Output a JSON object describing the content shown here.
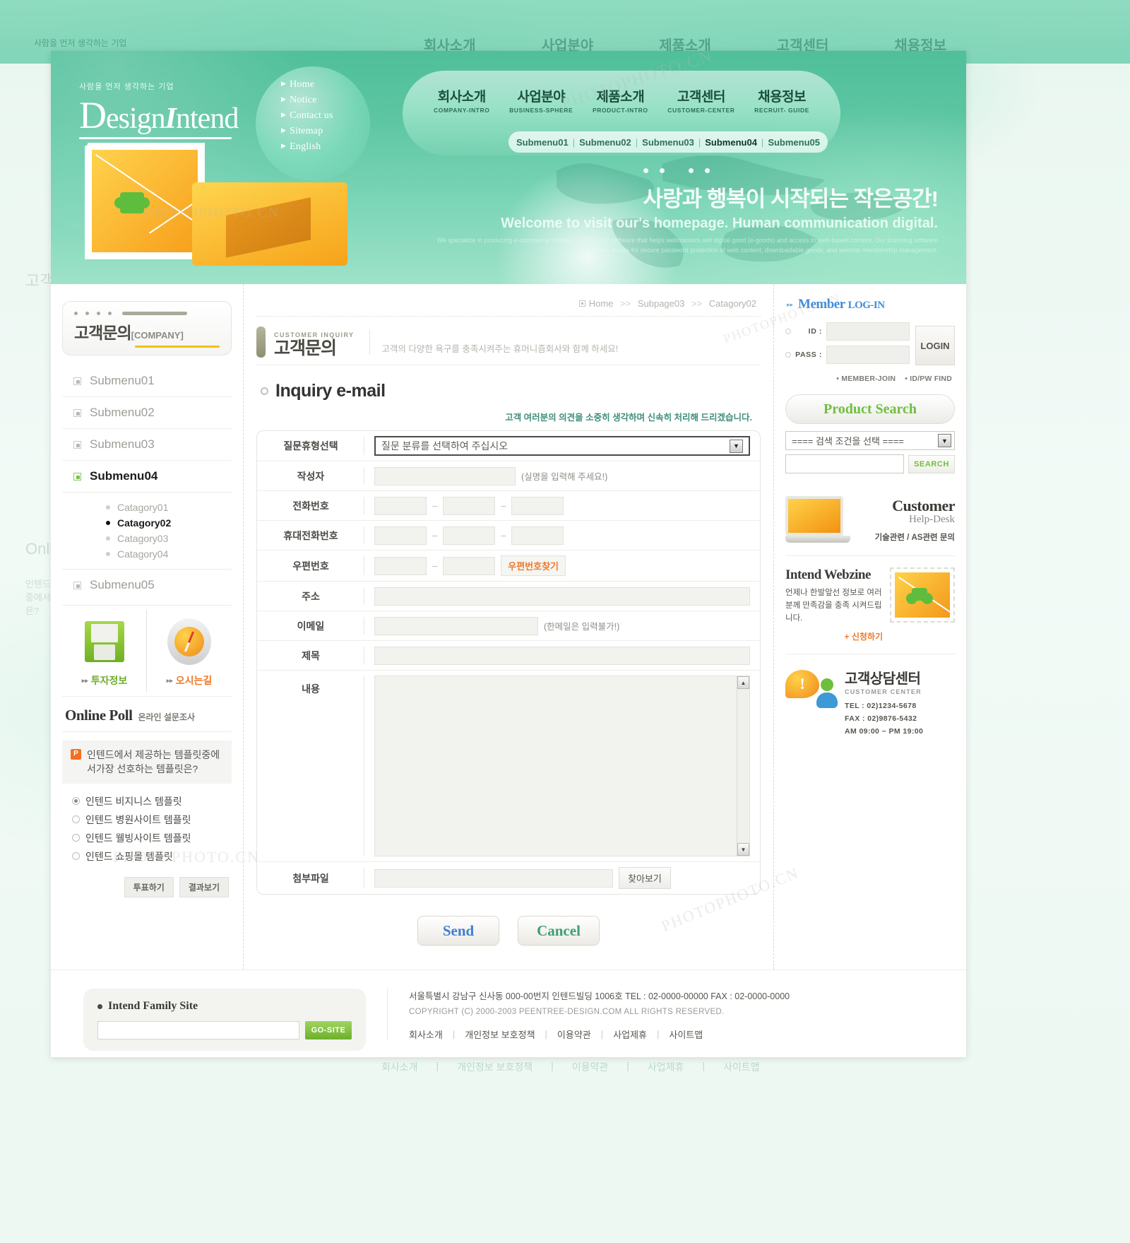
{
  "brand": {
    "tagline": "사람을 먼저 생각하는 기업",
    "name_d": "D",
    "name_rest": "esign",
    "name_i": "I",
    "name_end": "ntend"
  },
  "quicknav": [
    {
      "label": "Home"
    },
    {
      "label": "Notice"
    },
    {
      "label": "Contact us"
    },
    {
      "label": "Sitemap"
    },
    {
      "label": "English"
    }
  ],
  "gnb": [
    {
      "ko": "회사소개",
      "en": "COMPANY-INTRO"
    },
    {
      "ko": "사업분야",
      "en": "BUSINESS-SPHERE"
    },
    {
      "ko": "제품소개",
      "en": "PRODUCT-INTRO"
    },
    {
      "ko": "고객센터",
      "en": "CUSTOMER-CENTER"
    },
    {
      "ko": "채용정보",
      "en": "RECRUIT- GUIDE"
    }
  ],
  "submenus": [
    {
      "label": "Submenu01",
      "active": false
    },
    {
      "label": "Submenu02",
      "active": false
    },
    {
      "label": "Submenu03",
      "active": false
    },
    {
      "label": "Submenu04",
      "active": true
    },
    {
      "label": "Submenu05",
      "active": false
    }
  ],
  "hero": {
    "korean": "사랑과 행복이 시작되는 작은공간!",
    "english": "Welcome to visit our's homepage. Human communication digital.",
    "small": "We specialize in producing e-commerce software, particularly software that helps webmasters sell digital good (e-goods) and access to web-based content. Our licensing software includes scripts for secure password protection of web content, downloadable goods, and website membership management."
  },
  "sidebar": {
    "page_title": "고객문의",
    "page_title_suffix": "[COMPANY]",
    "menu": [
      {
        "label": "Submenu01",
        "active": false
      },
      {
        "label": "Submenu02",
        "active": false
      },
      {
        "label": "Submenu03",
        "active": false
      },
      {
        "label": "Submenu04",
        "active": true
      },
      {
        "label": "Submenu05",
        "active": false
      }
    ],
    "categories": [
      {
        "label": "Catagory01",
        "active": false
      },
      {
        "label": "Catagory02",
        "active": true
      },
      {
        "label": "Catagory03",
        "active": false
      },
      {
        "label": "Catagory04",
        "active": false
      }
    ],
    "banners": [
      {
        "label": "투자정보",
        "arrow": "▸▸",
        "icon": "floppy-disk-icon"
      },
      {
        "label": "오시는길",
        "arrow": "▸▸",
        "icon": "compass-icon"
      }
    ],
    "poll": {
      "title_en": "Online Poll",
      "title_ko": "온라인 설문조사",
      "badge": "P",
      "question": "인텐드에서 제공하는 템플릿중에서가장 선호하는 템플릿은?",
      "options": [
        {
          "label": "인텐드 비지니스 템플릿",
          "selected": true
        },
        {
          "label": "인텐드 병원사이트 템플릿",
          "selected": false
        },
        {
          "label": "인텐드 웰빙사이트 템플릿",
          "selected": false
        },
        {
          "label": "인텐드 쇼핑몰 템플릿",
          "selected": false
        }
      ],
      "vote_button": "투표하기",
      "result_button": "결과보기"
    }
  },
  "breadcrumb": {
    "home": "Home",
    "sep": ">>",
    "level2": "Subpage03",
    "level3": "Catagory02"
  },
  "section": {
    "en": "CUSTOMER INQUIRY",
    "ko": "고객문의",
    "desc": "고객의 다양한 욕구를 충족시켜주는 휴머니즘회사와 함께 하세요!"
  },
  "inquiry": {
    "heading": "Inquiry e-mail",
    "note": "고객 여러분의 의견을 소중히 생각하며 신속히 처리해 드리겠습니다.",
    "rows": [
      {
        "label": "질문휴형선택",
        "type": "select",
        "value": "질문 분류를 선택하여 주십시오"
      },
      {
        "label": "작성자",
        "type": "text",
        "hint": "(실명을 입력해 주세요!)"
      },
      {
        "label": "전화번호",
        "type": "phone3"
      },
      {
        "label": "휴대전화번호",
        "type": "phone3"
      },
      {
        "label": "우편번호",
        "type": "zip",
        "button": "우편번호찾기"
      },
      {
        "label": "주소",
        "type": "wide"
      },
      {
        "label": "이메일",
        "type": "mail",
        "hint": "(한메일은 입력불가!)"
      },
      {
        "label": "제목",
        "type": "wide"
      },
      {
        "label": "내용",
        "type": "textarea"
      },
      {
        "label": "첨부파일",
        "type": "file",
        "button": "찾아보기"
      }
    ],
    "send_button": "Send",
    "cancel_button": "Cancel"
  },
  "login": {
    "title_member": "Member ",
    "title_login": "LOG-IN",
    "id_label": "ID :",
    "pass_label": "PASS :",
    "button": "LOGIN",
    "link_join": "• MEMBER-JOIN",
    "link_find": "• ID/PW FIND"
  },
  "product_search": {
    "title": "Product Search",
    "select_value": "==== 검색 조건을 선택 ====",
    "search_button": "SEARCH"
  },
  "helpdesk": {
    "title": "Customer",
    "subtitle": "Help-Desk",
    "desc": "기술관련 / AS관련 문의"
  },
  "webzine": {
    "title": "Intend Webzine",
    "desc": "언제나 한발앞선 정보로 여러분께 만족감을 충족 시켜드립니다.",
    "apply": "+ 신청하기"
  },
  "call_center": {
    "title_ko": "고객상담센터",
    "title_en": "CUSTOMER CENTER",
    "tel": "TEL : 02)1234-5678",
    "fax": "FAX : 02)9876-5432",
    "hours": "AM 09:00 ~ PM 19:00"
  },
  "footer": {
    "family_title": "Intend Family Site",
    "go_button": "GO-SITE",
    "address": "서울특별시 강남구 신사동 000-00번지 인텐드빌딩 1006호 TEL : 02-0000-00000 FAX : 02-0000-0000",
    "copyright": "COPYRIGHT (C) 2000-2003 PEENTREE-DESIGN.COM  ALL RIGHTS RESERVED.",
    "links": [
      {
        "label": "회사소개"
      },
      {
        "label": "개인정보 보호정책"
      },
      {
        "label": "이용약관"
      },
      {
        "label": "사업제휴"
      },
      {
        "label": "사이트맵"
      }
    ]
  },
  "colors": {
    "header_green": "#4fbf9a",
    "accent_yellow": "#f2c100",
    "accent_orange": "#f0782a",
    "accent_blue": "#3f8ddb",
    "accent_green": "#6fbf3e"
  }
}
